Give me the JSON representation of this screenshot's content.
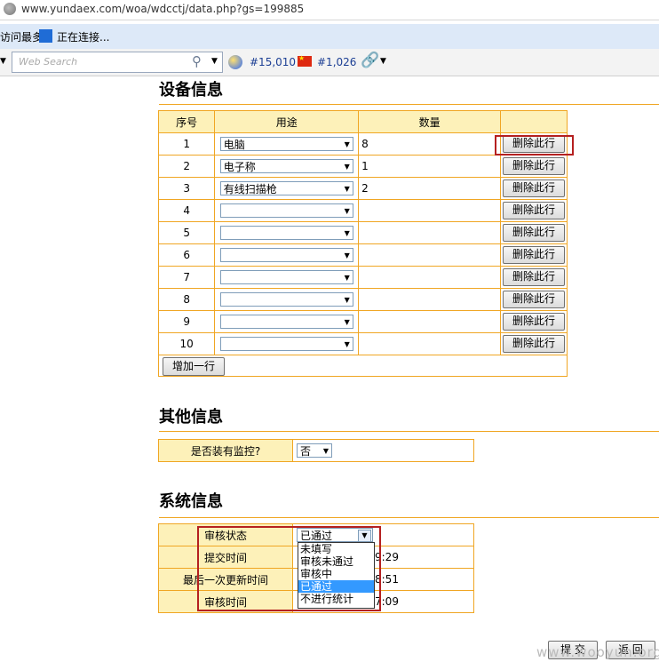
{
  "browser": {
    "url": "www.yundaex.com/woa/wdcctj/data.php?gs=199885",
    "bookmark_most": "访问最多",
    "bookmark_connecting": "正在连接...",
    "search_placeholder": "Web Search",
    "rank_global": "#15,010",
    "rank_china": "#1,026"
  },
  "device_section": {
    "title": "设备信息",
    "headers": [
      "序号",
      "用途",
      "数量",
      ""
    ],
    "rows": [
      {
        "no": "1",
        "use": "电脑",
        "qty": "8",
        "action": "删除此行"
      },
      {
        "no": "2",
        "use": "电子称",
        "qty": "1",
        "action": "删除此行"
      },
      {
        "no": "3",
        "use": "有线扫描枪",
        "qty": "2",
        "action": "删除此行"
      },
      {
        "no": "4",
        "use": "",
        "qty": "",
        "action": "删除此行"
      },
      {
        "no": "5",
        "use": "",
        "qty": "",
        "action": "删除此行"
      },
      {
        "no": "6",
        "use": "",
        "qty": "",
        "action": "删除此行"
      },
      {
        "no": "7",
        "use": "",
        "qty": "",
        "action": "删除此行"
      },
      {
        "no": "8",
        "use": "",
        "qty": "",
        "action": "删除此行"
      },
      {
        "no": "9",
        "use": "",
        "qty": "",
        "action": "删除此行"
      },
      {
        "no": "10",
        "use": "",
        "qty": "",
        "action": "删除此行"
      }
    ],
    "add_row": "增加一行"
  },
  "other_section": {
    "title": "其他信息",
    "monitor_label": "是否装有监控?",
    "monitor_value": "否"
  },
  "system_section": {
    "title": "系统信息",
    "fields": [
      {
        "label": "审核状态",
        "value": ""
      },
      {
        "label": "提交时间",
        "value": "9:29"
      },
      {
        "label": "最后一次更新时间",
        "value": "8:51"
      },
      {
        "label": "审核时间",
        "value": "7:09"
      }
    ],
    "status_selected": "已通过",
    "status_options": [
      "未填写",
      "审核未通过",
      "审核中",
      "已通过",
      "不进行统计"
    ]
  },
  "footer": {
    "submit": "提 交",
    "back": "返 回",
    "watermark": "www.wooyun.org"
  },
  "colors": {
    "border": "#f0a623",
    "header_bg": "#fdf1b9",
    "highlight": "#b52020",
    "option_selected": "#3399ff"
  }
}
